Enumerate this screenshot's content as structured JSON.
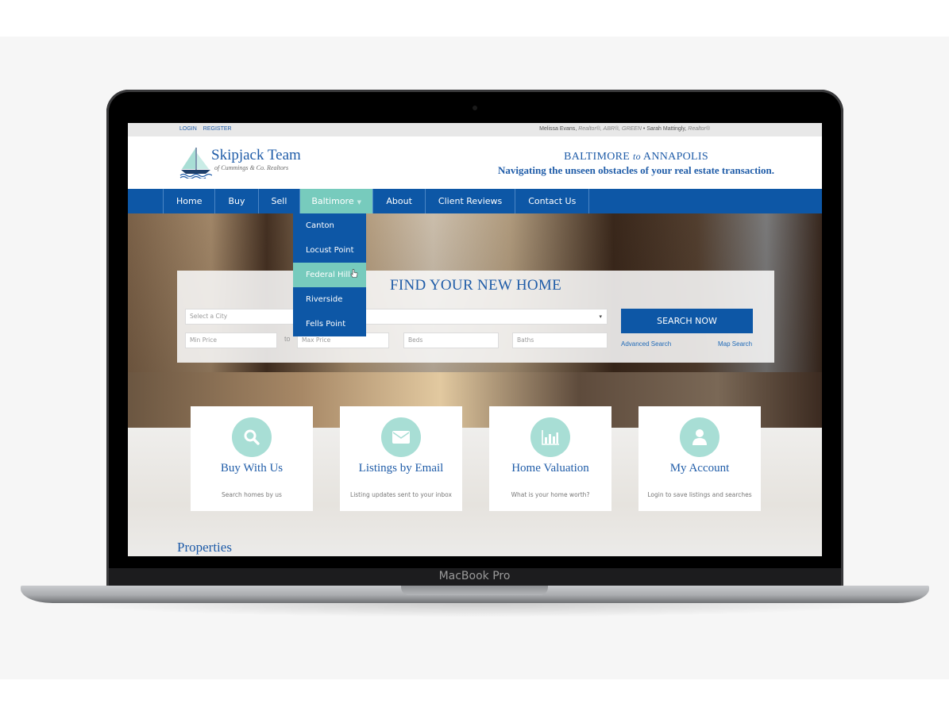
{
  "device": {
    "label": "MacBook Pro"
  },
  "topbar": {
    "login": "LOGIN",
    "register": "REGISTER",
    "agent1_name": "Melissa Evans",
    "agent1_creds": "Realtor®, ABR®, GREEN",
    "separator": "•",
    "agent2_name": "Sarah Mattingly",
    "agent2_creds": "Realtor®"
  },
  "header": {
    "logo_title": "Skipjack Team",
    "logo_subtitle": "of Cummings & Co. Realtors",
    "tagline_city1": "BALTIMORE",
    "tagline_to": "to",
    "tagline_city2": "ANNAPOLIS",
    "tagline_line2": "Navigating the unseen obstacles of your real estate transaction."
  },
  "nav": {
    "items": [
      {
        "label": "Home"
      },
      {
        "label": "Buy"
      },
      {
        "label": "Sell"
      },
      {
        "label": "Baltimore",
        "active": true,
        "has_dropdown": true
      },
      {
        "label": "About"
      },
      {
        "label": "Client Reviews"
      },
      {
        "label": "Contact Us"
      }
    ],
    "dropdown": {
      "items": [
        {
          "label": "Canton"
        },
        {
          "label": "Locust Point"
        },
        {
          "label": "Federal Hill",
          "hovered": true
        },
        {
          "label": "Riverside"
        },
        {
          "label": "Fells Point"
        }
      ]
    }
  },
  "search": {
    "title": "FIND YOUR NEW HOME",
    "city_placeholder": "Select a City",
    "min_price_placeholder": "Min Price",
    "to_label": "to",
    "max_price_placeholder": "Max Price",
    "beds_placeholder": "Beds",
    "baths_placeholder": "Baths",
    "button_label": "SEARCH NOW",
    "advanced_link": "Advanced Search",
    "map_link": "Map Search"
  },
  "cards": [
    {
      "icon": "search-icon",
      "title": "Buy With Us",
      "desc": "Search homes by us"
    },
    {
      "icon": "envelope-icon",
      "title": "Listings by Email",
      "desc": "Listing updates sent to your inbox"
    },
    {
      "icon": "bar-chart-icon",
      "title": "Home Valuation",
      "desc": "What is your home worth?"
    },
    {
      "icon": "user-icon",
      "title": "My Account",
      "desc": "Login to save listings and searches"
    }
  ],
  "sections": {
    "properties_title": "Properties"
  },
  "colors": {
    "brand_blue": "#0d57a6",
    "accent_teal": "#77cbbd",
    "icon_circle": "#a8ded5",
    "text_blue": "#1f5ca8"
  }
}
